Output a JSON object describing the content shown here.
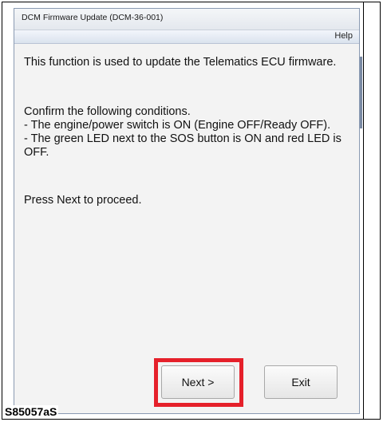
{
  "window": {
    "title": "DCM Firmware Update (DCM-36-001)",
    "menu_help": "Help"
  },
  "body": {
    "intro": "This function is used to update the Telematics ECU firmware.",
    "conditions": "Confirm the following conditions.\n- The engine/power switch is ON (Engine OFF/Ready OFF).\n- The green LED next to the SOS button is ON and red LED is OFF.",
    "instruction": "Press Next to proceed."
  },
  "buttons": {
    "next_label": "Next >",
    "exit_label": "Exit"
  },
  "highlight": {
    "color": "#e5202a",
    "target": "next-button"
  },
  "figure": {
    "label": "S85057aS"
  }
}
